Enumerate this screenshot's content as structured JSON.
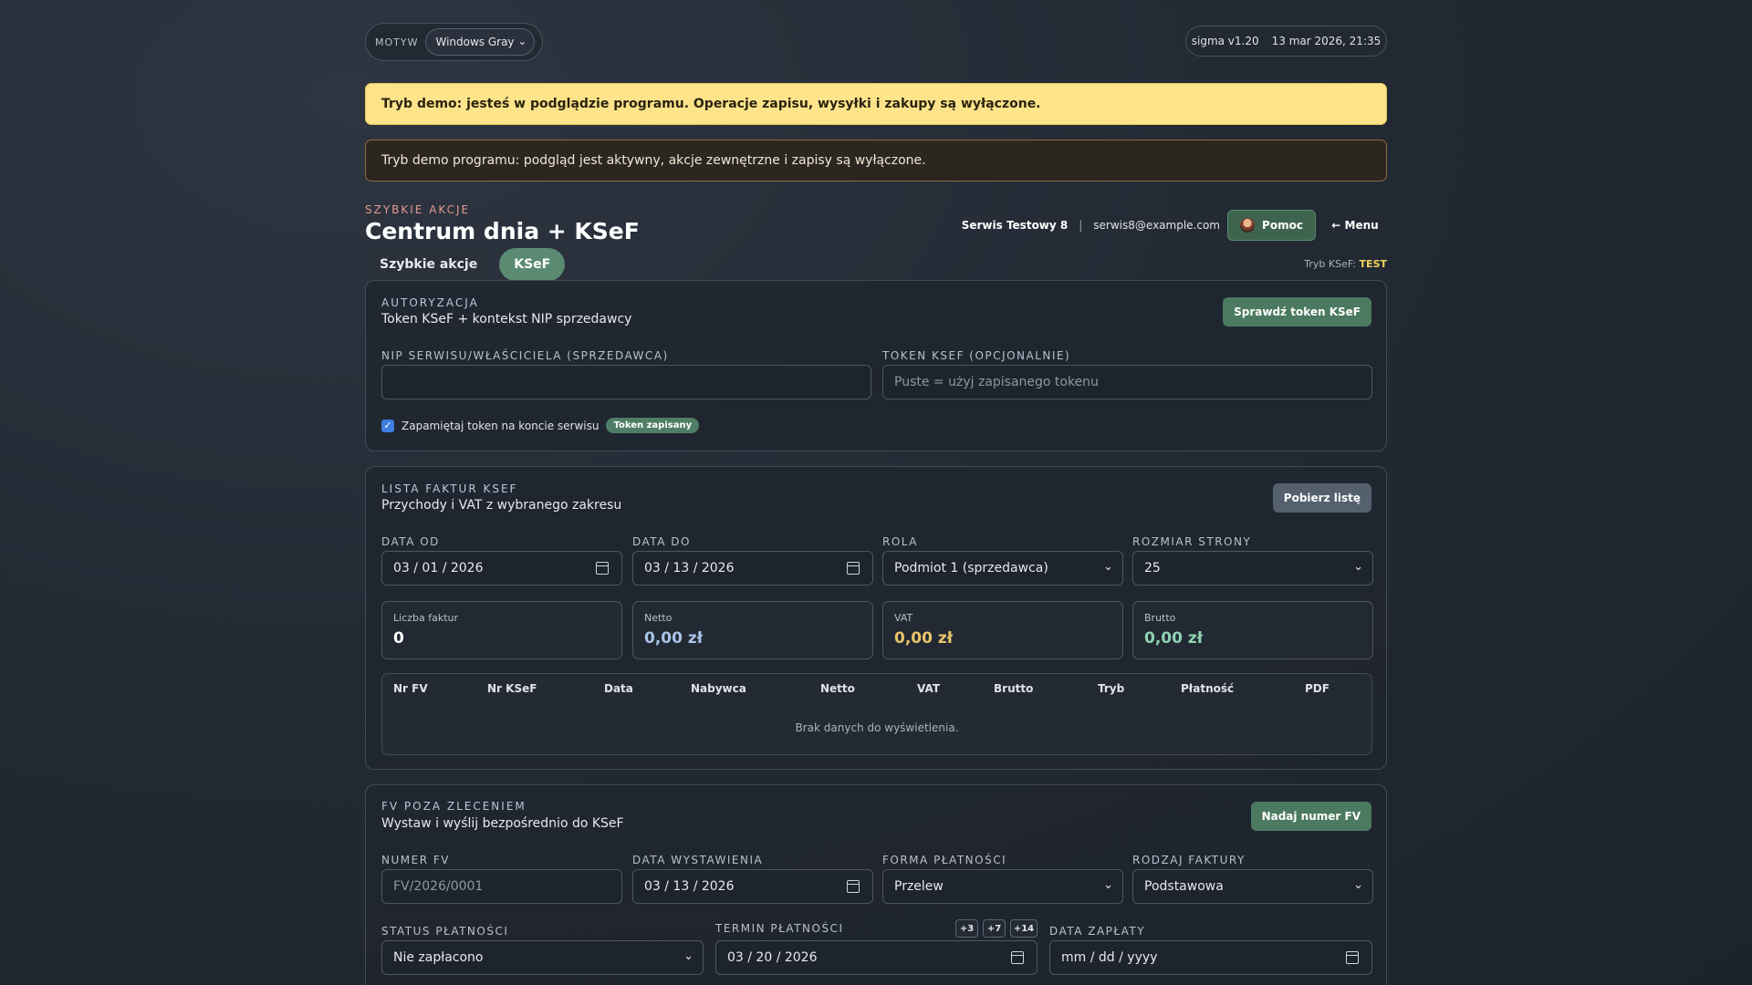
{
  "topbar": {
    "theme_label": "MOTYW",
    "theme_value": "Windows Gray",
    "version": "sigma v1.20",
    "datetime": "13 mar 2026, 21:35"
  },
  "banners": {
    "demo_warning": "Tryb demo: jesteś w podglądzie programu. Operacje zapisu, wysyłki i zakupy są wyłączone.",
    "demo_info": "Tryb demo programu: podgląd jest aktywny, akcje zewnętrzne i zapisy są wyłączone."
  },
  "header": {
    "eyebrow": "SZYBKIE AKCJE",
    "title": "Centrum dnia + KSeF",
    "user_name": "Serwis Testowy 8",
    "separator": "|",
    "user_email": "serwis8@example.com",
    "help_label": "Pomoc",
    "menu_label": "← Menu",
    "ksef_mode_label": "Tryb KSeF:",
    "ksef_mode_value": "TEST"
  },
  "tabs": [
    {
      "label": "Szybkie akcje",
      "active": false
    },
    {
      "label": "KSeF",
      "active": true
    }
  ],
  "auth": {
    "eyebrow": "AUTORYZACJA",
    "subtitle": "Token KSeF + kontekst NIP sprzedawcy",
    "check_button": "Sprawdź token KSeF",
    "nip_label": "NIP SERWISU/WŁAŚCICIELA (SPRZEDAWCA)",
    "nip_value": "",
    "token_label": "TOKEN KSEF (OPCJONALNIE)",
    "token_placeholder": "Puste = użyj zapisanego tokenu",
    "remember_label": "Zapamiętaj token na koncie serwisu",
    "remember_checked": true,
    "token_badge": "Token zapisany"
  },
  "invoice_list": {
    "eyebrow": "LISTA FAKTUR KSEF",
    "subtitle": "Przychody i VAT z wybranego zakresu",
    "fetch_button": "Pobierz listę",
    "date_from_label": "DATA OD",
    "date_from": "03 / 01 / 2026",
    "date_to_label": "DATA DO",
    "date_to": "03 / 13 / 2026",
    "role_label": "ROLA",
    "role_value": "Podmiot 1 (sprzedawca)",
    "page_size_label": "ROZMIAR STRONY",
    "page_size_value": "25",
    "stats": [
      {
        "label": "Liczba faktur",
        "value": "0",
        "color": "#ffffff"
      },
      {
        "label": "Netto",
        "value": "0,00 zł",
        "color": "#a9c4e6"
      },
      {
        "label": "VAT",
        "value": "0,00 zł",
        "color": "#e9c46a"
      },
      {
        "label": "Brutto",
        "value": "0,00 zł",
        "color": "#8fd3b2"
      }
    ],
    "columns": [
      "Nr FV",
      "Nr KSeF",
      "Data",
      "Nabywca",
      "Netto",
      "VAT",
      "Brutto",
      "Tryb",
      "Płatność",
      "PDF"
    ],
    "empty_text": "Brak danych do wyświetlenia."
  },
  "fv_outside": {
    "eyebrow": "FV POZA ZLECENIEM",
    "subtitle": "Wystaw i wyślij bezpośrednio do KSeF",
    "assign_button": "Nadaj numer FV",
    "number_label": "NUMER FV",
    "number_placeholder": "FV/2026/0001",
    "issue_date_label": "DATA WYSTAWIENIA",
    "issue_date": "03 / 13 / 2026",
    "payment_form_label": "FORMA PŁATNOŚCI",
    "payment_form": "Przelew",
    "invoice_type_label": "RODZAJ FAKTURY",
    "invoice_type": "Podstawowa",
    "payment_status_label": "STATUS PŁATNOŚCI",
    "payment_status": "Nie zapłacono",
    "due_date_label": "TERMIN PŁATNOŚCI",
    "due_date": "03 / 20 / 2026",
    "quick_days": [
      "+3",
      "+7",
      "+14"
    ],
    "paid_date_label": "DATA ZAPŁATY",
    "paid_date_placeholder": "mm / dd / yyyy"
  }
}
